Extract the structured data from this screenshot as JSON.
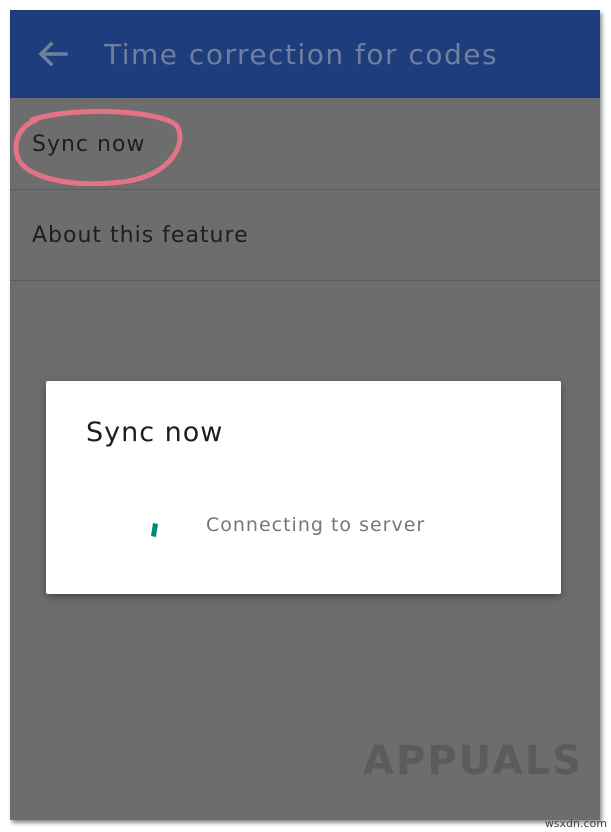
{
  "appbar": {
    "title": "Time correction for codes",
    "back_icon": "arrow-left-icon",
    "background": "#1d3d7c"
  },
  "list": {
    "items": [
      {
        "label": "Sync now",
        "highlighted": true
      },
      {
        "label": "About this feature",
        "highlighted": false
      }
    ],
    "highlight_color": "#e57387"
  },
  "dialog": {
    "title": "Sync now",
    "message": "Connecting to server",
    "spinner_color": "#00897b"
  },
  "watermark": {
    "text": "APPUALS",
    "site": "wsxdn.com"
  }
}
